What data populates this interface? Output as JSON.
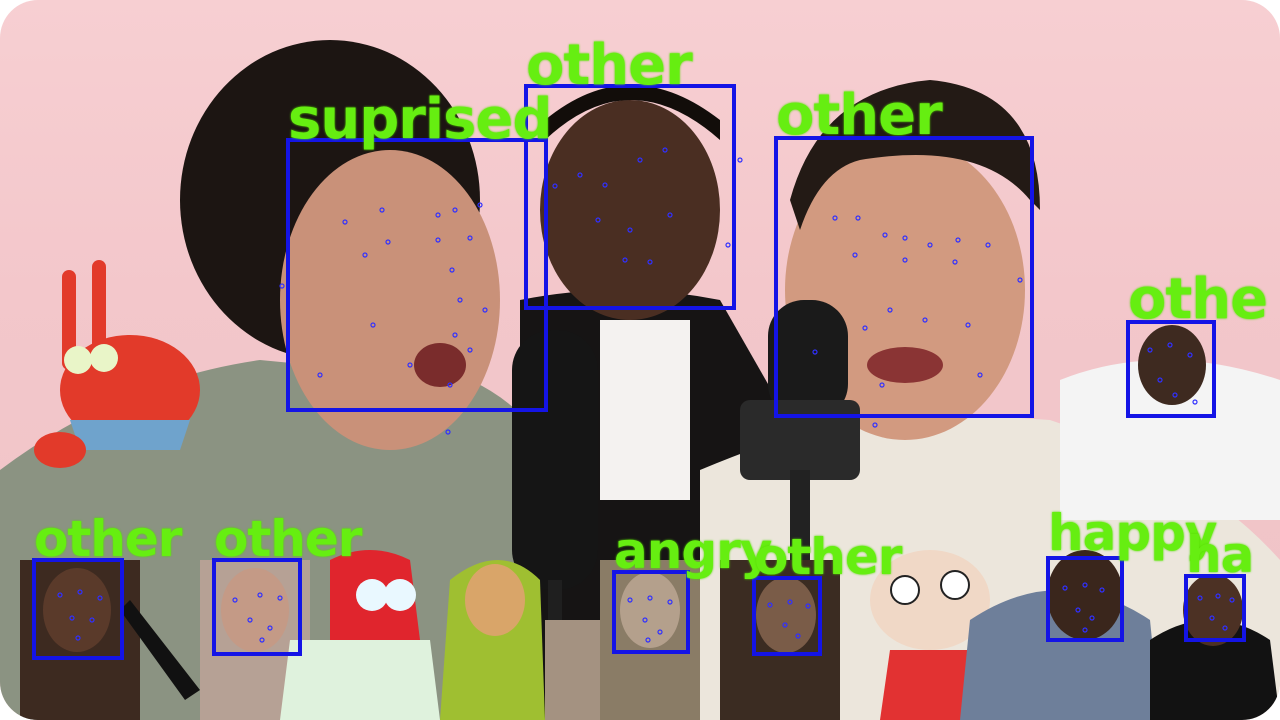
{
  "colors": {
    "label_green": "#66ee11",
    "box_blue": "#1414e6",
    "landmark_blue": "#3030ff"
  },
  "detections": [
    {
      "label": "suprised"
    },
    {
      "label": "other"
    },
    {
      "label": "other"
    },
    {
      "label": "othe"
    },
    {
      "label": "other"
    },
    {
      "label": "other"
    },
    {
      "label": "angry"
    },
    {
      "label": "other"
    },
    {
      "label": "happy"
    },
    {
      "label": "ha"
    }
  ]
}
